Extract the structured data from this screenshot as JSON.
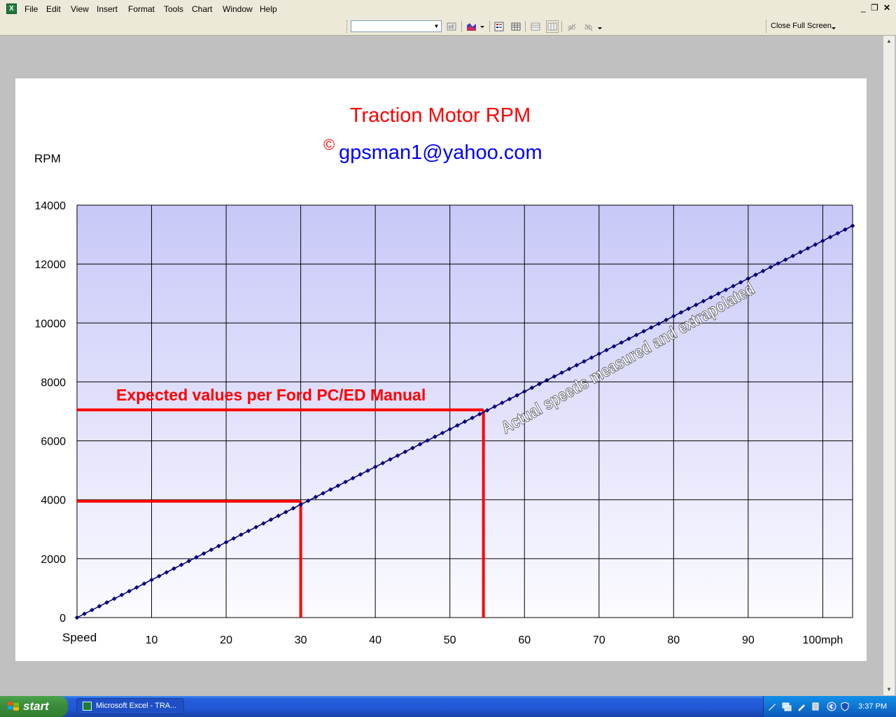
{
  "menubar": {
    "items": [
      "File",
      "Edit",
      "View",
      "Insert",
      "Format",
      "Tools",
      "Chart",
      "Window",
      "Help"
    ],
    "window_controls": [
      "_",
      "❐"
    ]
  },
  "toolbar": {
    "combo_value": "",
    "close_full_screen": "Close Full Screen",
    "buttons": [
      "format-chart-icon",
      "chart-type-icon",
      "legend-icon",
      "data-table-icon",
      "by-row-icon",
      "by-column-icon",
      "angle-clockwise-icon",
      "angle-counterclockwise-icon"
    ]
  },
  "chart_data": {
    "type": "line",
    "title": "Traction Motor RPM",
    "subtitle_symbol": "©",
    "subtitle": "gpsman1@yahoo.com",
    "xlabel": "Speed",
    "ylabel": "RPM",
    "x_ticks": [
      "10",
      "20",
      "30",
      "40",
      "50",
      "60",
      "70",
      "80",
      "90",
      "100mph"
    ],
    "y_ticks": [
      "0",
      "2000",
      "4000",
      "6000",
      "8000",
      "10000",
      "12000",
      "14000"
    ],
    "xlim": [
      0,
      104
    ],
    "ylim": [
      0,
      14000
    ],
    "grid": true,
    "plot_colors": {
      "top": "#c8c8f8",
      "bottom": "#fbfbff",
      "line": "#000066",
      "marker": "#000080",
      "reference": "#ff0000",
      "title": "#ff0000",
      "subtitle": "#0000ff"
    },
    "series": [
      {
        "x": [
          0,
          104
        ],
        "y": [
          0,
          13300
        ],
        "marker_spacing_mph": 1
      }
    ],
    "reference_lines": [
      {
        "x": 30,
        "y": 3950
      },
      {
        "x": 54.5,
        "y": 7050
      }
    ],
    "annotations": [
      {
        "text": "Expected values per Ford PC/ED Manual",
        "color": "#ff0000"
      },
      {
        "text": "Actual speeds measured and extrapolated",
        "color": "#ffffff"
      }
    ]
  },
  "taskbar": {
    "start": "start",
    "task": "Microsoft Excel - TRA...",
    "clock": "3:37 PM"
  }
}
